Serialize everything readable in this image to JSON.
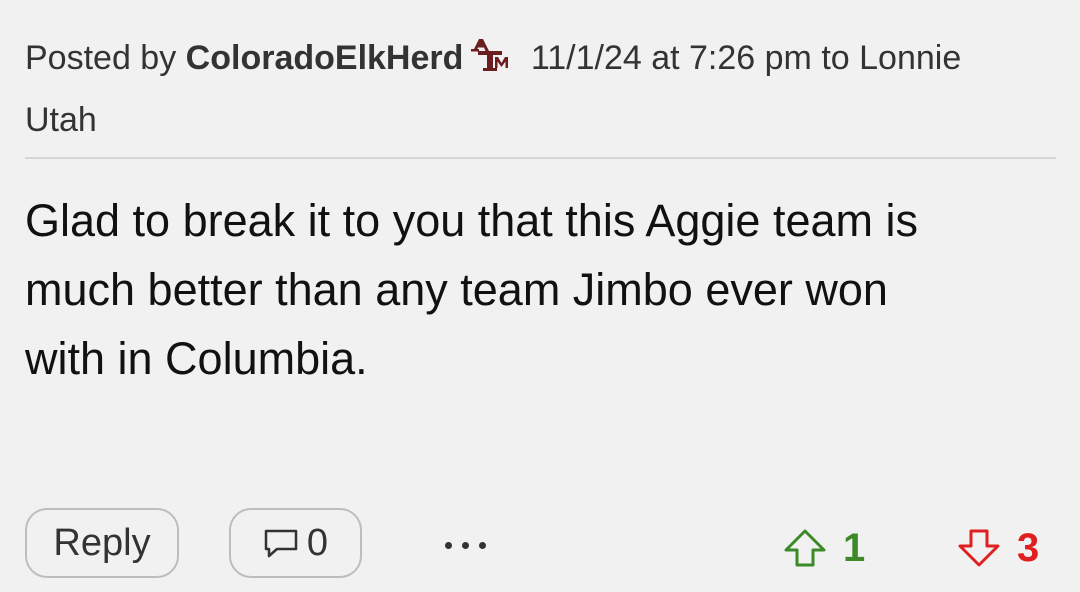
{
  "post": {
    "posted_by_label": "Posted by",
    "author": "ColoradoElkHerd",
    "author_logo_text": "ATM",
    "timestamp": "11/1/24 at 7:26 pm",
    "to_label": "to",
    "recipient_line1": "Lonnie",
    "recipient_line2": "Utah",
    "body_lines": [
      "Glad to break it to you that this Aggie team is",
      "much better than any team Jimbo ever won",
      "with in Columbia."
    ]
  },
  "actions": {
    "reply_label": "Reply",
    "comment_count": "0",
    "upvotes": "1",
    "downvotes": "3"
  },
  "colors": {
    "logo": "#6b1e1e",
    "upvote": "#3b8a27",
    "downvote": "#e02020"
  },
  "icons": [
    "aggie-logo-icon",
    "comment-bubble-icon",
    "more-dots-icon",
    "upvote-arrow-icon",
    "downvote-arrow-icon"
  ]
}
